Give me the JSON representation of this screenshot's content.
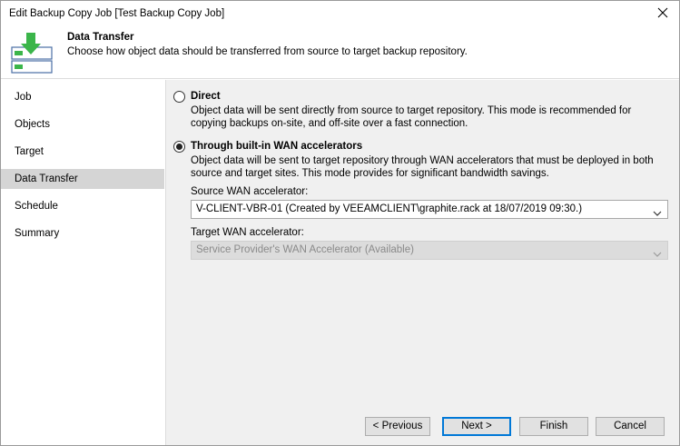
{
  "window": {
    "title": "Edit Backup Copy Job [Test Backup Copy Job]"
  },
  "header": {
    "title": "Data Transfer",
    "description": "Choose how object data should be transferred from source to target backup repository."
  },
  "sidebar": {
    "items": [
      {
        "label": "Job",
        "active": false
      },
      {
        "label": "Objects",
        "active": false
      },
      {
        "label": "Target",
        "active": false
      },
      {
        "label": "Data Transfer",
        "active": true
      },
      {
        "label": "Schedule",
        "active": false
      },
      {
        "label": "Summary",
        "active": false
      }
    ]
  },
  "options": {
    "direct": {
      "label": "Direct",
      "selected": false,
      "description": "Object data will be sent directly from source to target repository. This mode is recommended for copying backups on-site, and off-site over a fast connection."
    },
    "wan": {
      "label": "Through built-in WAN accelerators",
      "selected": true,
      "description": "Object data will be sent to target repository through WAN accelerators that must be deployed in both source and target sites. This mode provides for significant bandwidth savings."
    }
  },
  "source_wan": {
    "label": "Source WAN accelerator:",
    "value": "V-CLIENT-VBR-01 (Created by VEEAMCLIENT\\graphite.rack at 18/07/2019 09:30.)"
  },
  "target_wan": {
    "label": "Target WAN accelerator:",
    "value": "Service Provider's WAN Accelerator (Available)",
    "disabled": true
  },
  "buttons": {
    "previous": "< Previous",
    "next": "Next >",
    "finish": "Finish",
    "cancel": "Cancel"
  },
  "colors": {
    "accent": "#0078d7",
    "icon_green": "#3bb54a",
    "active_nav": "#d5d5d5"
  },
  "icons": {
    "header": "data-transfer-icon",
    "close": "close-icon",
    "chevron": "chevron-down-icon"
  }
}
